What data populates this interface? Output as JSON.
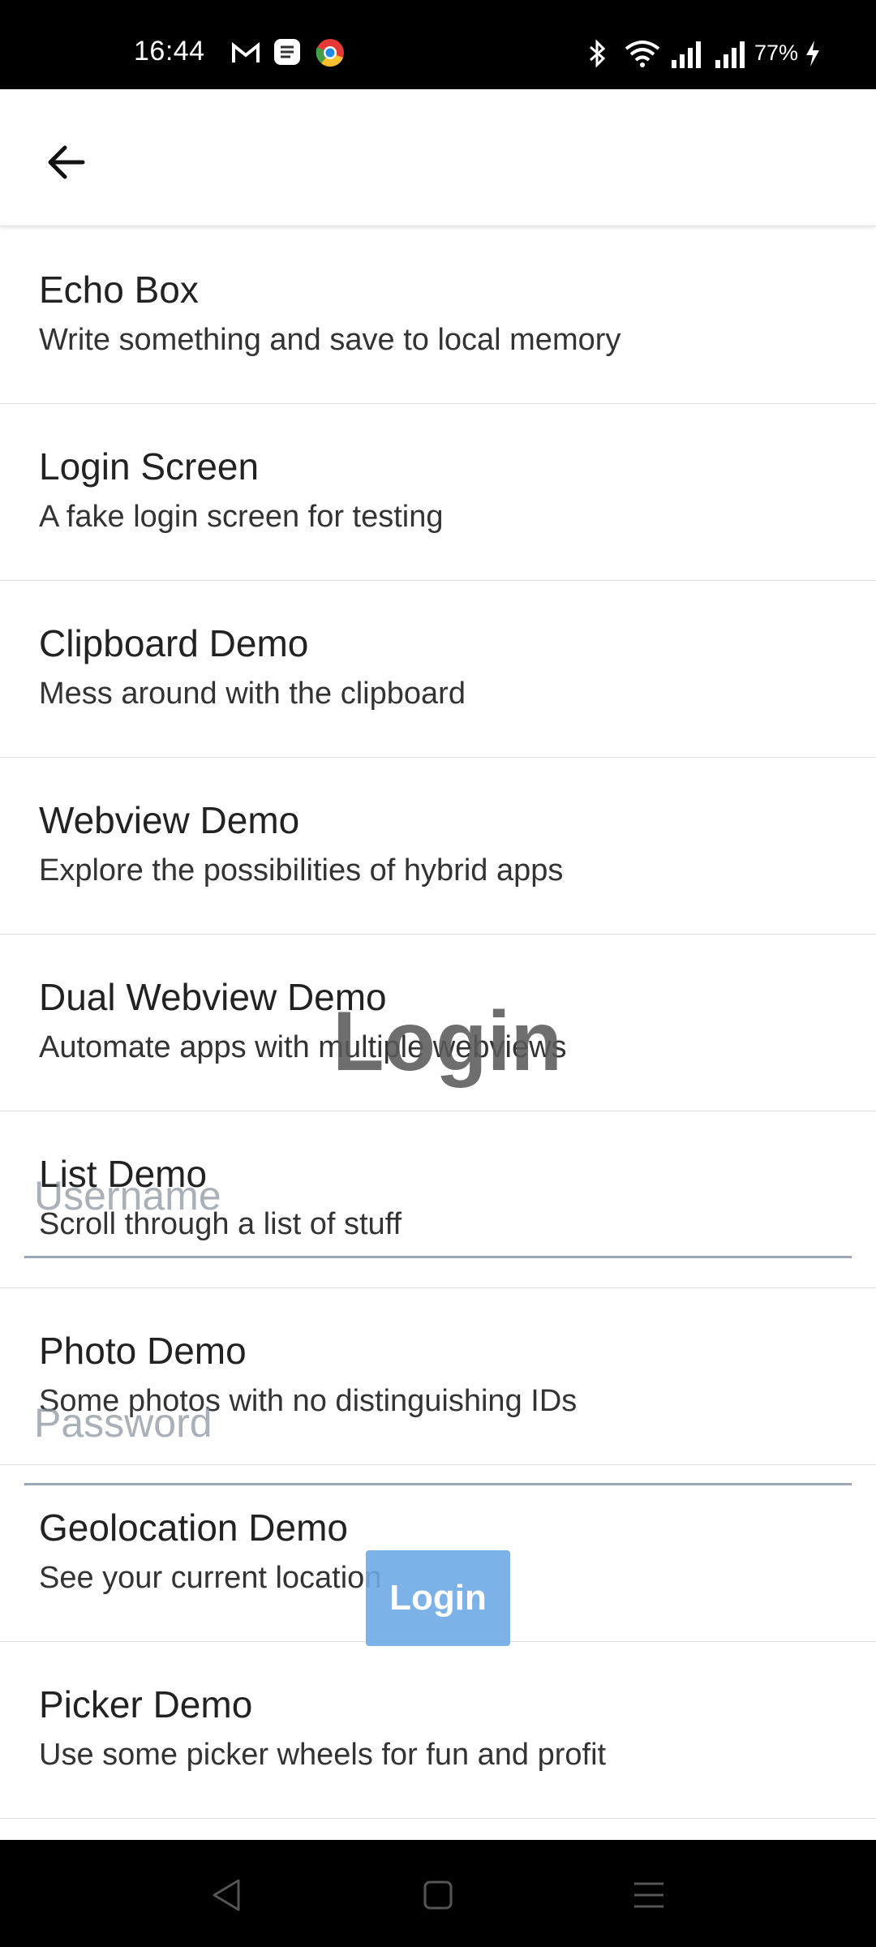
{
  "status_bar": {
    "time": "16:44",
    "battery": "77%",
    "icons": [
      "gmail-icon",
      "app-icon",
      "chrome-icon",
      "bluetooth-icon",
      "wifi-icon",
      "signal-icon",
      "signal-icon",
      "charging-icon"
    ]
  },
  "app_bar": {
    "back_icon": "arrow-back-icon"
  },
  "list": {
    "items": [
      {
        "title": "Echo Box",
        "subtitle": "Write something and save to local memory"
      },
      {
        "title": "Login Screen",
        "subtitle": "A fake login screen for testing"
      },
      {
        "title": "Clipboard Demo",
        "subtitle": "Mess around with the clipboard"
      },
      {
        "title": "Webview Demo",
        "subtitle": "Explore the possibilities of hybrid apps"
      },
      {
        "title": "Dual Webview Demo",
        "subtitle": "Automate apps with multiple webviews"
      },
      {
        "title": "List Demo",
        "subtitle": "Scroll through a list of stuff"
      },
      {
        "title": "Photo Demo",
        "subtitle": "Some photos with no distinguishing IDs"
      },
      {
        "title": "Geolocation Demo",
        "subtitle": "See your current location"
      },
      {
        "title": "Picker Demo",
        "subtitle": "Use some picker wheels for fun and profit"
      }
    ]
  },
  "login_overlay": {
    "title": "Login",
    "username_placeholder": "Username",
    "password_placeholder": "Password",
    "button_label": "Login"
  },
  "nav_bar": {
    "back": "nav-back-icon",
    "home": "nav-home-icon",
    "recents": "nav-recents-icon"
  }
}
